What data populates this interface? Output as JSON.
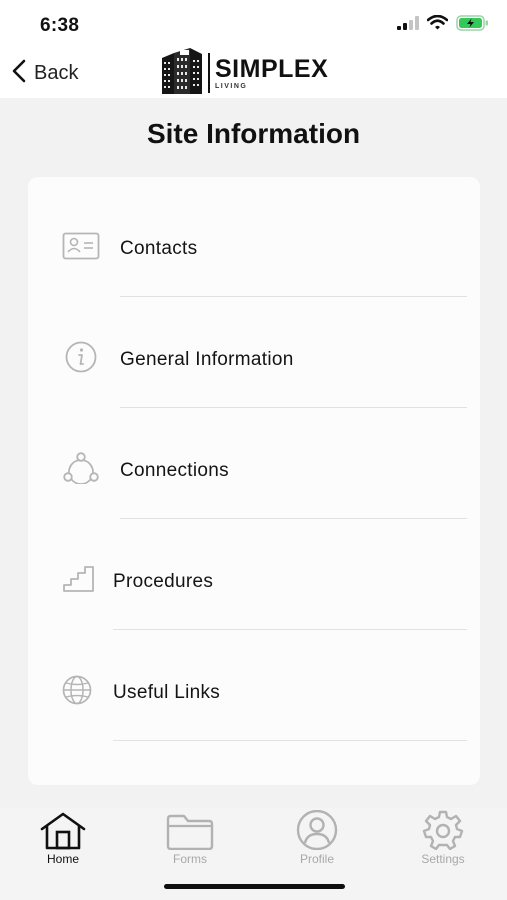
{
  "status_bar": {
    "time": "6:38",
    "icons": [
      "signal-icon",
      "wifi-icon",
      "battery-charging-icon"
    ],
    "battery_color": "#34c759"
  },
  "nav": {
    "back_label": "Back",
    "logo_main": "SIMPLEX",
    "logo_sub": "LIVING"
  },
  "page": {
    "title": "Site Information"
  },
  "menu": {
    "items": [
      {
        "label": "Contacts",
        "icon": "contact-card-icon"
      },
      {
        "label": "General Information",
        "icon": "info-icon"
      },
      {
        "label": "Connections",
        "icon": "connections-icon"
      },
      {
        "label": "Procedures",
        "icon": "stairs-icon"
      },
      {
        "label": "Useful Links",
        "icon": "globe-icon"
      }
    ]
  },
  "tabs": {
    "items": [
      {
        "label": "Home",
        "icon": "home-icon",
        "active": true
      },
      {
        "label": "Forms",
        "icon": "folder-icon",
        "active": false
      },
      {
        "label": "Profile",
        "icon": "profile-icon",
        "active": false
      },
      {
        "label": "Settings",
        "icon": "gear-icon",
        "active": false
      }
    ]
  },
  "colors": {
    "active_tab": "#111111",
    "inactive_tab": "#a8a8a8",
    "icon_gray": "#b5b5b5"
  }
}
